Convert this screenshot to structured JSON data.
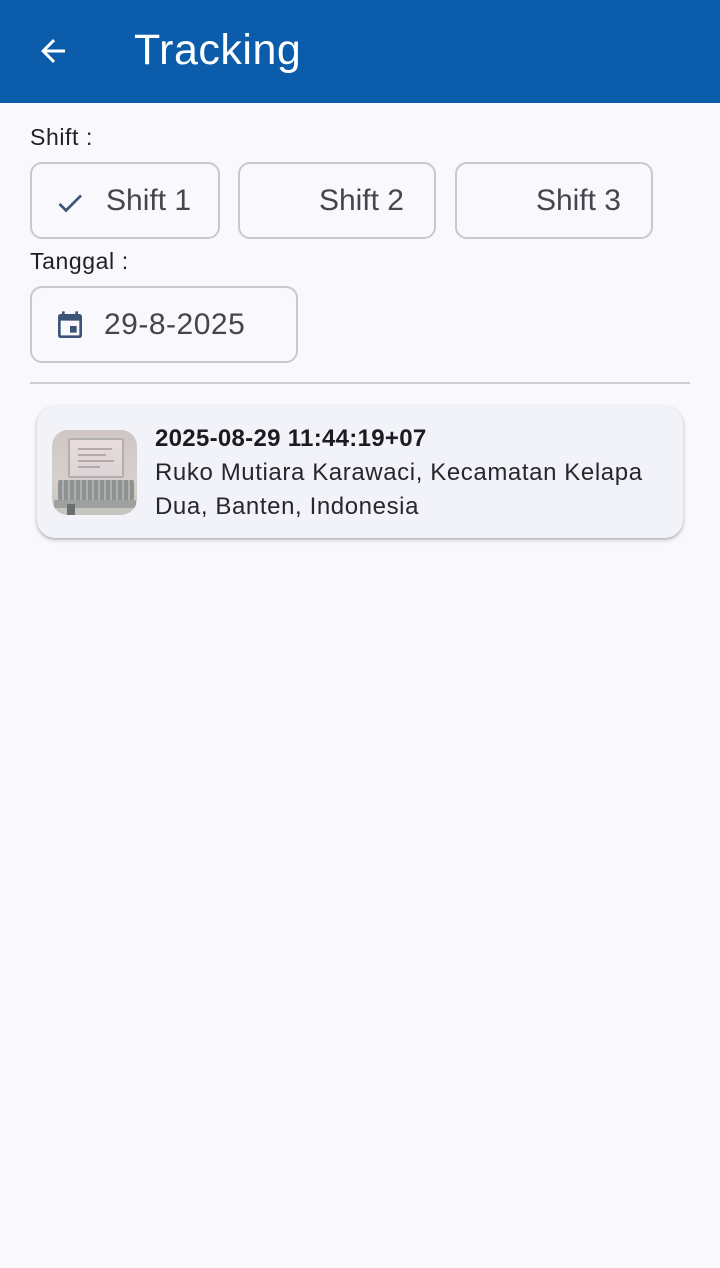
{
  "appbar": {
    "title": "Tracking",
    "back_icon": "arrow-back-icon",
    "color": "#0c5cac"
  },
  "shift": {
    "label": "Shift :",
    "options": [
      {
        "label": "Shift 1",
        "selected": true
      },
      {
        "label": "Shift 2",
        "selected": false
      },
      {
        "label": "Shift 3",
        "selected": false
      }
    ]
  },
  "tanggal": {
    "label": "Tanggal :",
    "value": "29-8-2025",
    "icon": "calendar-icon"
  },
  "tracking_list": [
    {
      "timestamp": "2025-08-29 11:44:19+07",
      "address": "Ruko Mutiara Karawaci, Kecamatan Kelapa Dua, Banten, Indonesia",
      "thumbnail": "laptop-photo"
    }
  ]
}
